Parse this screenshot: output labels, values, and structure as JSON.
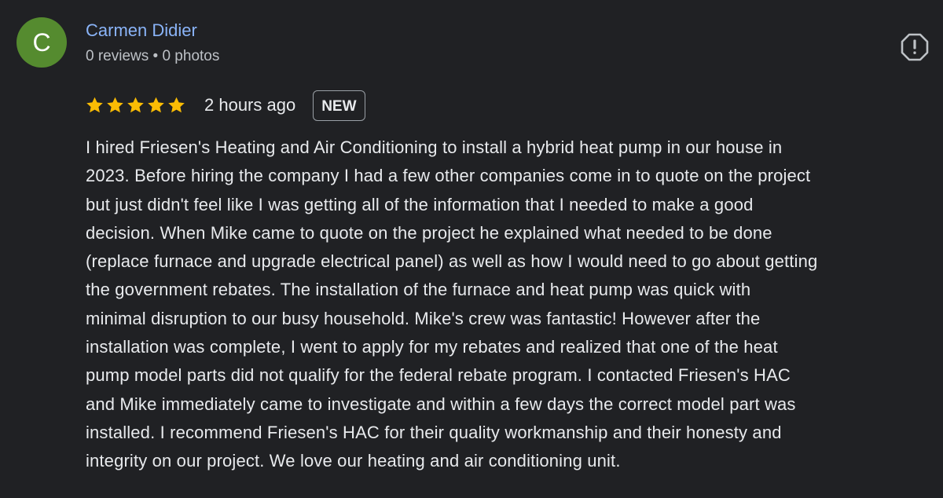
{
  "author": {
    "avatar_letter": "C",
    "avatar_color": "#558b2f",
    "name": "Carmen Didier",
    "meta": "0 reviews • 0 photos"
  },
  "report_icon": "report-exclamation-icon",
  "rating": {
    "stars": 5,
    "max_stars": 5,
    "star_color": "#fbbc04"
  },
  "time_ago": "2 hours ago",
  "badge": "NEW",
  "review_lines": [
    "I hired Friesen's Heating and Air Conditioning to install a hybrid heat pump in our house in",
    "2023. Before hiring the company I had a few other companies come in to quote on the project",
    "but just didn't feel like I was getting all of the information that I needed to make a good",
    "decision. When Mike came to quote on the project he explained what needed to be done",
    "(replace furnace and upgrade electrical panel) as well as how I would need to go about getting",
    "the government rebates. The installation of the furnace and heat pump was quick with",
    "minimal disruption to our busy household. Mike's crew was fantastic! However after the",
    "installation was complete, I went to apply for my rebates and realized that one of the heat",
    "pump model parts did not qualify for the federal rebate program. I contacted Friesen's HAC",
    "and Mike immediately came to investigate and within a few days the correct model part was",
    "installed. I recommend Friesen's HAC for their quality workmanship and their honesty and",
    "integrity on our project. We love our heating and air conditioning unit."
  ]
}
